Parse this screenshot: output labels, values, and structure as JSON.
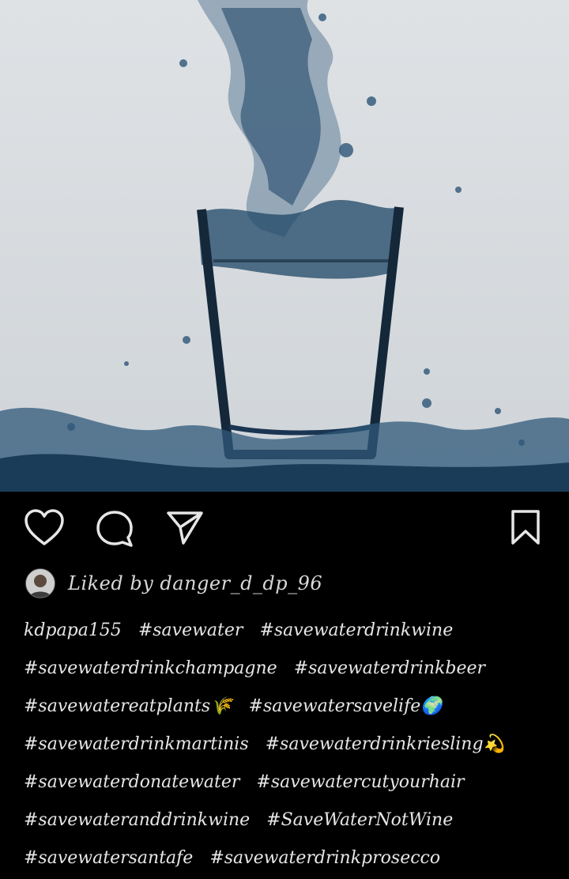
{
  "post": {
    "image_alt": "Water splashing out of a glass",
    "liked_by": "Liked by danger_d_dp_96",
    "username": "kdpapa155",
    "caption_lines": [
      [
        "kdpapa155",
        "#savewater",
        "#savewaterdrinkwine"
      ],
      [
        "#savewaterdrinkchampagne",
        "#savewaterdrinkbeer"
      ],
      [
        "#savewatereatplants🌾",
        "#savewatersavelife🌍"
      ],
      [
        "#savewaterdrinkmartinis",
        "#savewaterdrinkriesling💫"
      ],
      [
        "#savewaterdonatewater",
        "#savewatercutyourhair"
      ],
      [
        "#savewateranddrinkwine",
        "#SaveWaterNotWine"
      ],
      [
        "#savewatersantafe",
        "#savewaterdrinkprosecco"
      ]
    ]
  },
  "icons": {
    "like": "heart-icon",
    "comment": "comment-icon",
    "share": "send-icon",
    "save": "bookmark-icon"
  }
}
